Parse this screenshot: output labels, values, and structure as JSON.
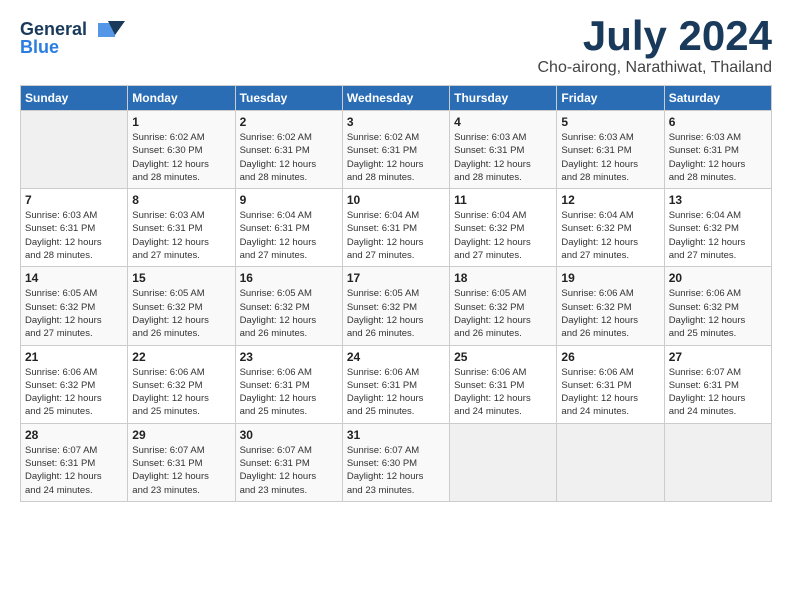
{
  "logo": {
    "line1": "General",
    "line2": "Blue"
  },
  "title": "July 2024",
  "subtitle": "Cho-airong, Narathiwat, Thailand",
  "days_header": [
    "Sunday",
    "Monday",
    "Tuesday",
    "Wednesday",
    "Thursday",
    "Friday",
    "Saturday"
  ],
  "weeks": [
    [
      {
        "day": "",
        "info": ""
      },
      {
        "day": "1",
        "info": "Sunrise: 6:02 AM\nSunset: 6:30 PM\nDaylight: 12 hours\nand 28 minutes."
      },
      {
        "day": "2",
        "info": "Sunrise: 6:02 AM\nSunset: 6:31 PM\nDaylight: 12 hours\nand 28 minutes."
      },
      {
        "day": "3",
        "info": "Sunrise: 6:02 AM\nSunset: 6:31 PM\nDaylight: 12 hours\nand 28 minutes."
      },
      {
        "day": "4",
        "info": "Sunrise: 6:03 AM\nSunset: 6:31 PM\nDaylight: 12 hours\nand 28 minutes."
      },
      {
        "day": "5",
        "info": "Sunrise: 6:03 AM\nSunset: 6:31 PM\nDaylight: 12 hours\nand 28 minutes."
      },
      {
        "day": "6",
        "info": "Sunrise: 6:03 AM\nSunset: 6:31 PM\nDaylight: 12 hours\nand 28 minutes."
      }
    ],
    [
      {
        "day": "7",
        "info": "Sunrise: 6:03 AM\nSunset: 6:31 PM\nDaylight: 12 hours\nand 28 minutes."
      },
      {
        "day": "8",
        "info": "Sunrise: 6:03 AM\nSunset: 6:31 PM\nDaylight: 12 hours\nand 27 minutes."
      },
      {
        "day": "9",
        "info": "Sunrise: 6:04 AM\nSunset: 6:31 PM\nDaylight: 12 hours\nand 27 minutes."
      },
      {
        "day": "10",
        "info": "Sunrise: 6:04 AM\nSunset: 6:31 PM\nDaylight: 12 hours\nand 27 minutes."
      },
      {
        "day": "11",
        "info": "Sunrise: 6:04 AM\nSunset: 6:32 PM\nDaylight: 12 hours\nand 27 minutes."
      },
      {
        "day": "12",
        "info": "Sunrise: 6:04 AM\nSunset: 6:32 PM\nDaylight: 12 hours\nand 27 minutes."
      },
      {
        "day": "13",
        "info": "Sunrise: 6:04 AM\nSunset: 6:32 PM\nDaylight: 12 hours\nand 27 minutes."
      }
    ],
    [
      {
        "day": "14",
        "info": "Sunrise: 6:05 AM\nSunset: 6:32 PM\nDaylight: 12 hours\nand 27 minutes."
      },
      {
        "day": "15",
        "info": "Sunrise: 6:05 AM\nSunset: 6:32 PM\nDaylight: 12 hours\nand 26 minutes."
      },
      {
        "day": "16",
        "info": "Sunrise: 6:05 AM\nSunset: 6:32 PM\nDaylight: 12 hours\nand 26 minutes."
      },
      {
        "day": "17",
        "info": "Sunrise: 6:05 AM\nSunset: 6:32 PM\nDaylight: 12 hours\nand 26 minutes."
      },
      {
        "day": "18",
        "info": "Sunrise: 6:05 AM\nSunset: 6:32 PM\nDaylight: 12 hours\nand 26 minutes."
      },
      {
        "day": "19",
        "info": "Sunrise: 6:06 AM\nSunset: 6:32 PM\nDaylight: 12 hours\nand 26 minutes."
      },
      {
        "day": "20",
        "info": "Sunrise: 6:06 AM\nSunset: 6:32 PM\nDaylight: 12 hours\nand 25 minutes."
      }
    ],
    [
      {
        "day": "21",
        "info": "Sunrise: 6:06 AM\nSunset: 6:32 PM\nDaylight: 12 hours\nand 25 minutes."
      },
      {
        "day": "22",
        "info": "Sunrise: 6:06 AM\nSunset: 6:32 PM\nDaylight: 12 hours\nand 25 minutes."
      },
      {
        "day": "23",
        "info": "Sunrise: 6:06 AM\nSunset: 6:31 PM\nDaylight: 12 hours\nand 25 minutes."
      },
      {
        "day": "24",
        "info": "Sunrise: 6:06 AM\nSunset: 6:31 PM\nDaylight: 12 hours\nand 25 minutes."
      },
      {
        "day": "25",
        "info": "Sunrise: 6:06 AM\nSunset: 6:31 PM\nDaylight: 12 hours\nand 24 minutes."
      },
      {
        "day": "26",
        "info": "Sunrise: 6:06 AM\nSunset: 6:31 PM\nDaylight: 12 hours\nand 24 minutes."
      },
      {
        "day": "27",
        "info": "Sunrise: 6:07 AM\nSunset: 6:31 PM\nDaylight: 12 hours\nand 24 minutes."
      }
    ],
    [
      {
        "day": "28",
        "info": "Sunrise: 6:07 AM\nSunset: 6:31 PM\nDaylight: 12 hours\nand 24 minutes."
      },
      {
        "day": "29",
        "info": "Sunrise: 6:07 AM\nSunset: 6:31 PM\nDaylight: 12 hours\nand 23 minutes."
      },
      {
        "day": "30",
        "info": "Sunrise: 6:07 AM\nSunset: 6:31 PM\nDaylight: 12 hours\nand 23 minutes."
      },
      {
        "day": "31",
        "info": "Sunrise: 6:07 AM\nSunset: 6:30 PM\nDaylight: 12 hours\nand 23 minutes."
      },
      {
        "day": "",
        "info": ""
      },
      {
        "day": "",
        "info": ""
      },
      {
        "day": "",
        "info": ""
      }
    ]
  ]
}
